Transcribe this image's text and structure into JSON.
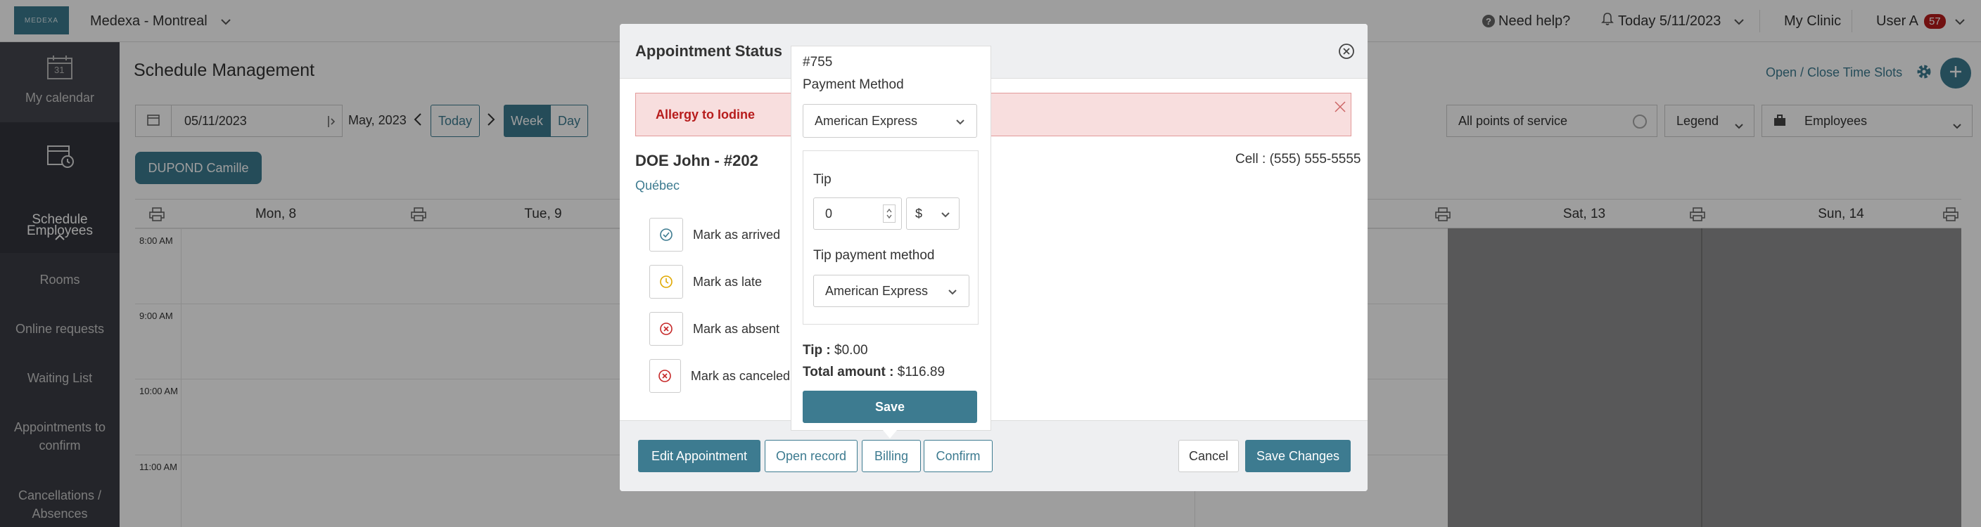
{
  "topbar": {
    "logo_text": "MEDEXA",
    "clinic_name": "Medexa - Montreal",
    "help": "Need help?",
    "today": "Today 5/11/2023",
    "my_clinic": "My Clinic",
    "user": "User A",
    "notif_count": "57"
  },
  "sidebar": {
    "my_calendar": "My calendar",
    "schedule": "Schedule",
    "employees": "Employees",
    "rooms": "Rooms",
    "online_requests": "Online requests",
    "waiting_list": "Waiting List",
    "appointments_to_confirm": "Appointments to confirm",
    "cancellations": "Cancellations / Absences",
    "calendar_day": "31"
  },
  "main": {
    "title": "Schedule Management",
    "open_close": "Open / Close Time Slots",
    "date_value": "05/11/2023",
    "month": "May, 2023",
    "today_btn": "Today",
    "week_btn": "Week",
    "day_btn": "Day",
    "points_of_service": "All points of service",
    "legend": "Legend",
    "employees": "Employees",
    "employee_chip": "DUPOND Camille",
    "days": [
      "Mon, 8",
      "Tue, 9",
      "Sat, 13",
      "Sun, 14"
    ],
    "times": [
      "8:00 AM",
      "9:00 AM",
      "10:00 AM",
      "11:00 AM"
    ]
  },
  "modal": {
    "title": "Appointment Status",
    "alert": "Allergy to Iodine",
    "patient": "DOE John - #202",
    "province": "Québec",
    "cell": "Cell : (555) 555-5555",
    "actions": [
      "Mark as arrived",
      "Mark as late",
      "Mark as absent",
      "Mark as canceled"
    ],
    "footer": {
      "edit": "Edit Appointment",
      "open_record": "Open record",
      "billing": "Billing",
      "confirm": "Confirm",
      "cancel": "Cancel",
      "save_changes": "Save Changes"
    }
  },
  "popover": {
    "invoice": "#755",
    "payment_method_label": "Payment Method",
    "payment_method": "American Express",
    "tip_label": "Tip",
    "tip_value": "0",
    "currency": "$",
    "tip_method_label": "Tip payment method",
    "tip_method": "American Express",
    "tip_summary_label": "Tip :",
    "tip_summary_value": "$0.00",
    "total_label": "Total amount :",
    "total_value": "$116.89",
    "save": "Save"
  },
  "colors": {
    "accent": "#3d7b90",
    "sidebar": "#3b3d45",
    "alert_bg": "#f8dede",
    "alert_text": "#b71c1c",
    "badge": "#b71c1c"
  }
}
